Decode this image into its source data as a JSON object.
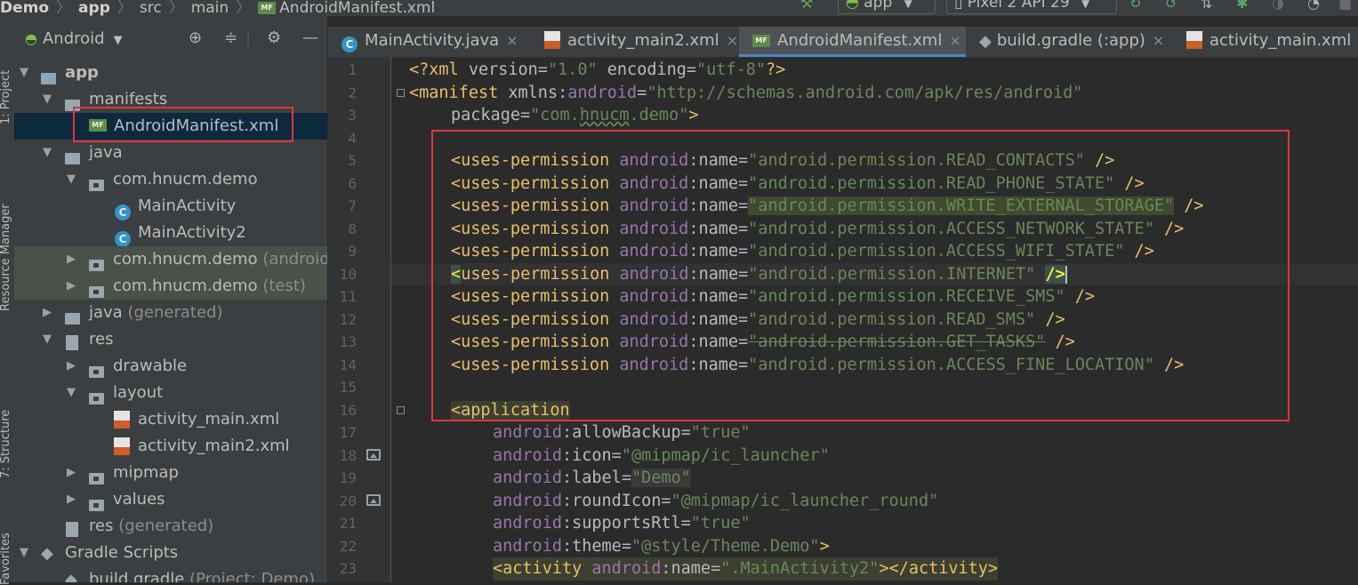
{
  "breadcrumbs": {
    "project": "Demo",
    "module": "app",
    "dir1": "src",
    "dir2": "main",
    "file_badge": "MF",
    "file": "AndroidManifest.xml"
  },
  "toolbar": {
    "run_config": "app",
    "device": "Pixel 2 API 29"
  },
  "left_strip": {
    "project_tool": "1: Project",
    "resource_manager": "Resource Manager",
    "structure_tool": "7: Structure",
    "favorites_tool": "Favorites"
  },
  "project_panel": {
    "view_mode": "Android",
    "tree": [
      {
        "label": "app",
        "hint": ""
      },
      {
        "label": "manifests",
        "hint": ""
      },
      {
        "label": "AndroidManifest.xml",
        "hint": "",
        "badge": "MF"
      },
      {
        "label": "java",
        "hint": ""
      },
      {
        "label": "com.hnucm.demo",
        "hint": ""
      },
      {
        "label": "MainActivity",
        "hint": "",
        "badge": "C"
      },
      {
        "label": "MainActivity2",
        "hint": "",
        "badge": "C"
      },
      {
        "label": "com.hnucm.demo",
        "hint": "(androidTest)"
      },
      {
        "label": "com.hnucm.demo",
        "hint": "(test)"
      },
      {
        "label": "java",
        "hint": "(generated)"
      },
      {
        "label": "res",
        "hint": ""
      },
      {
        "label": "drawable",
        "hint": ""
      },
      {
        "label": "layout",
        "hint": ""
      },
      {
        "label": "activity_main.xml",
        "hint": ""
      },
      {
        "label": "activity_main2.xml",
        "hint": ""
      },
      {
        "label": "mipmap",
        "hint": ""
      },
      {
        "label": "values",
        "hint": ""
      },
      {
        "label": "res",
        "hint": "(generated)"
      },
      {
        "label": "Gradle Scripts",
        "hint": ""
      },
      {
        "label": "build.gradle",
        "hint": "(Project: Demo)"
      }
    ]
  },
  "tabs": [
    {
      "label": "MainActivity.java",
      "badge": "C"
    },
    {
      "label": "activity_main2.xml",
      "badge": "<>"
    },
    {
      "label": "AndroidManifest.xml",
      "badge": "MF",
      "active": true
    },
    {
      "label": "build.gradle (:app)"
    },
    {
      "label": "activity_main.xml",
      "badge": "<>"
    }
  ],
  "tab_close_glyph": "×",
  "editor": {
    "line_numbers": [
      "1",
      "2",
      "3",
      "4",
      "5",
      "6",
      "7",
      "8",
      "9",
      "10",
      "11",
      "12",
      "13",
      "14",
      "15",
      "16",
      "17",
      "18",
      "19",
      "20",
      "21",
      "22",
      "23"
    ],
    "code": {
      "l1": {
        "a": "<?xml ",
        "b": "version",
        "c": "=",
        "d": "\"1.0\"",
        "e": " ",
        "f": "encoding",
        "g": "=",
        "h": "\"utf-8\"",
        "i": "?>"
      },
      "l2": {
        "a": "<manifest ",
        "b": "xmlns",
        "c": ":",
        "d": "android",
        "e": "=",
        "f": "\"http://schemas.android.com/apk/res/android\""
      },
      "l3": {
        "a": "package",
        "b": "=",
        "c": "\"com.",
        "d": "hnucm",
        "e": ".demo\"",
        "f": ">"
      },
      "perm_tag": "<uses-permission ",
      "ns": "android",
      "colon": ":",
      "name_attr": "name",
      "eq": "=",
      "close": " />",
      "close_bare": "/>",
      "permissions": [
        "\"android.permission.READ_CONTACTS\"",
        "\"android.permission.READ_PHONE_STATE\"",
        "\"android.permission.WRITE_EXTERNAL_STORAGE\"",
        "\"android.permission.ACCESS_NETWORK_STATE\"",
        "\"android.permission.ACCESS_WIFI_STATE\"",
        "\"android.permission.INTERNET\"",
        "\"android.permission.RECEIVE_SMS\"",
        "\"android.permission.READ_SMS\"",
        "\"android.permission.GET_TASKS\"",
        "\"android.permission.ACCESS_FINE_LOCATION\""
      ],
      "l16": "<application",
      "l17": {
        "attr": "allowBackup",
        "val": "\"true\""
      },
      "l18": {
        "attr": "icon",
        "val": "\"@mipmap/ic_launcher\""
      },
      "l19": {
        "attr": "label",
        "val": "\"Demo\""
      },
      "l20": {
        "attr": "roundIcon",
        "val": "\"@mipmap/ic_launcher_round\""
      },
      "l21": {
        "attr": "supportsRtl",
        "val": "\"true\""
      },
      "l22": {
        "attr": "theme",
        "val": "\"@style/Theme.Demo\"",
        "end": ">"
      },
      "l23": {
        "open": "<activity ",
        "attr": "name",
        "val": "\".MainActivity2\"",
        "close": "></activity>"
      }
    }
  }
}
